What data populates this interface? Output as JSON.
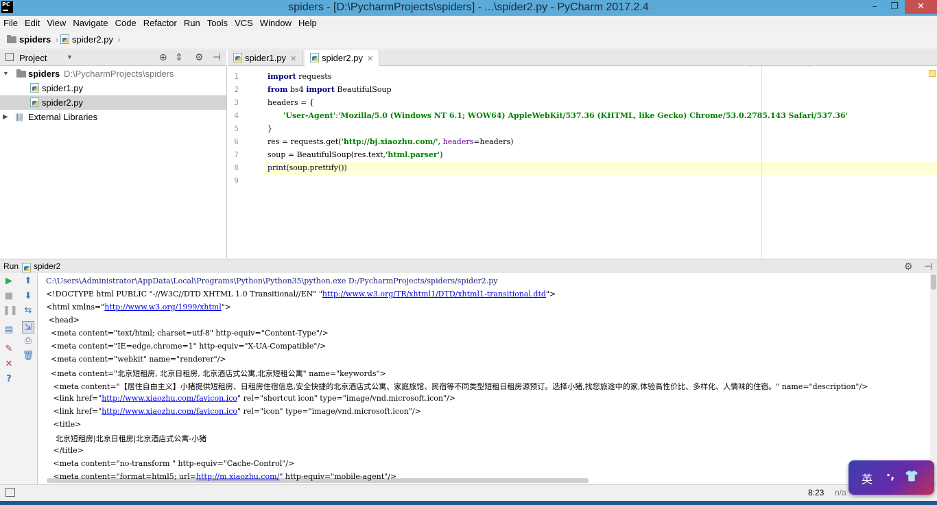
{
  "window": {
    "title": "spiders - [D:\\PycharmProjects\\spiders] - ...\\spider2.py - PyCharm 2017.2.4",
    "min": "–",
    "max": "❐",
    "close": "✕"
  },
  "menu": [
    "File",
    "Edit",
    "View",
    "Navigate",
    "Code",
    "Refactor",
    "Run",
    "Tools",
    "VCS",
    "Window",
    "Help"
  ],
  "breadcrumb": {
    "project": "spiders",
    "file": "spider2.py"
  },
  "run_config": "spider2",
  "project_panel": {
    "header": "Project",
    "root_name": "spiders",
    "root_path": "D:\\PycharmProjects\\spiders",
    "files": [
      "spider1.py",
      "spider2.py"
    ],
    "external": "External Libraries"
  },
  "tabs": [
    "spider1.py",
    "spider2.py"
  ],
  "editor": {
    "line_numbers": [
      "1",
      "2",
      "3",
      "4",
      "5",
      "6",
      "7",
      "8",
      "9"
    ],
    "lines": [
      {
        "a": "import",
        "b": " requests"
      },
      {
        "a": "from",
        "b": " bs4 ",
        "c": "import",
        "d": " BeautifulSoup"
      },
      {
        "a": "headers = {"
      },
      {
        "s": "'User-Agent'",
        "t": ":",
        "u": "'Mozilla/5.0 (Windows NT 6.1; WOW64) AppleWebKit/537.36 (KHTML, like Gecko) Chrome/53.0.2785.143 Safari/537.36'"
      },
      {
        "a": "}"
      },
      {
        "a": "res = requests.get(",
        "s": "'http://bj.xiaozhu.com/'",
        "b": ", ",
        "p": "headers",
        "c": "=headers)"
      },
      {
        "a": "soup = BeautifulSoup(res.text,",
        "s": "'html.parser'",
        "b": ")"
      },
      {
        "a": "print",
        "b": "(soup.prettify())"
      }
    ]
  },
  "run_panel": {
    "label": "Run",
    "config": "spider2",
    "output": [
      {
        "text": "C:\\Users\\Administrator\\AppData\\Local\\Programs\\Python\\Python35\\python.exe D:/PycharmProjects/spiders/spider2.py"
      },
      {
        "pre": "<!DOCTYPE html PUBLIC \"-//W3C//DTD XHTML 1.0 Transitional//EN\" \"",
        "link": "http://www.w3.org/TR/xhtml1/DTD/xhtml1-transitional.dtd",
        "post": "\">"
      },
      {
        "pre": "<html xmlns=\"",
        "link": "http://www.w3.org/1999/xhtml",
        "post": "\">"
      },
      {
        "text": " <head>"
      },
      {
        "text": "  <meta content=\"text/html; charset=utf-8\" http-equiv=\"Content-Type\"/>"
      },
      {
        "text": "  <meta content=\"IE=edge,chrome=1\" http-equiv=\"X-UA-Compatible\"/>"
      },
      {
        "text": "  <meta content=\"webkit\" name=\"renderer\"/>"
      },
      {
        "text": "  <meta content=\"北京短租房, 北京日租房, 北京酒店式公寓,北京短租公寓\" name=\"keywords\">"
      },
      {
        "text": "   <meta content=\"【居住自由主义】小猪提供短租房、日租房住宿信息,安全快捷的北京酒店式公寓、家庭旅馆、民宿等不同类型短租日租房源预订。选择小猪,找您旅途中的家,体验高性价比、多样化、人情味的住宿。\" name=\"description\"/>"
      },
      {
        "pre": "   <link href=\"",
        "link": "http://www.xiaozhu.com/favicon.ico",
        "post": "\" rel=\"shortcut icon\" type=\"image/vnd.microsoft.icon\"/>"
      },
      {
        "pre": "   <link href=\"",
        "link": "http://www.xiaozhu.com/favicon.ico",
        "post": "\" rel=\"icon\" type=\"image/vnd.microsoft.icon\"/>"
      },
      {
        "text": "   <title>"
      },
      {
        "text": "    北京短租房|北京日租房|北京酒店式公寓-小猪"
      },
      {
        "text": "   </title>"
      },
      {
        "text": "   <meta content=\"no-transform \" http-equiv=\"Cache-Control\"/>"
      },
      {
        "pre": "   <meta content=\"format=html5; url=",
        "link": "http://m.xiaozhu.com/",
        "post": "\" http-equiv=\"mobile-agent\"/>"
      }
    ]
  },
  "status": {
    "position": "8:23",
    "na": "n/a"
  },
  "ime": {
    "lang": "英",
    "punct": "·,"
  }
}
